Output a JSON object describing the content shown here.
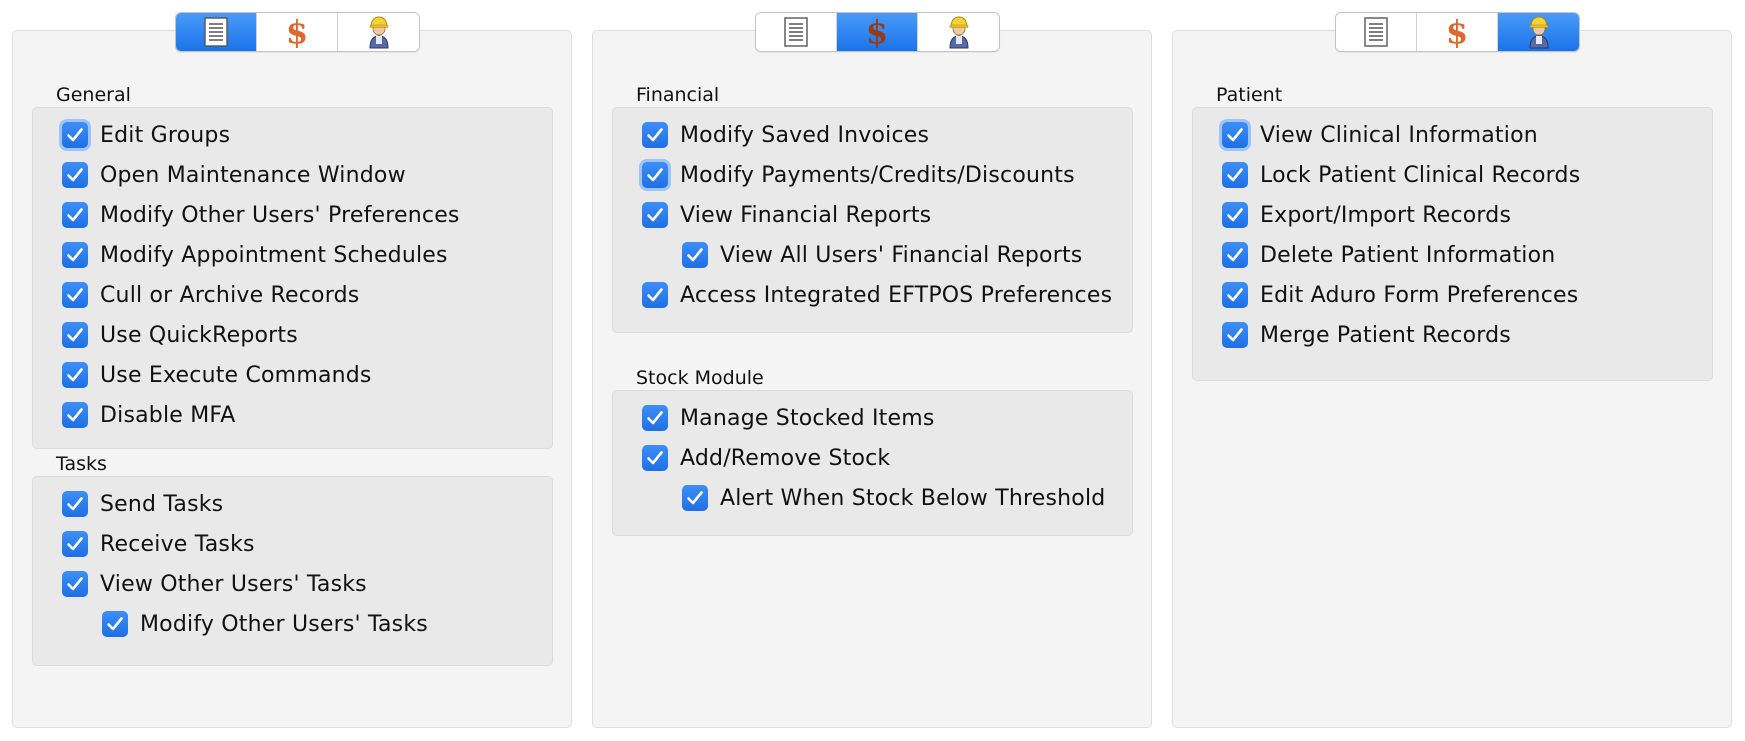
{
  "tab_icons": [
    "document-icon",
    "dollar-icon",
    "user-icon"
  ],
  "dollar_glyph": "$",
  "colors": {
    "accent": "#1f6fe5",
    "panel_bg": "#f4f4f4",
    "group_bg": "#e9e9e9",
    "dollar": "#e0662d"
  },
  "panels": [
    {
      "active_tab": 0,
      "sections": [
        {
          "title": "General",
          "items": [
            {
              "label": "Edit Groups",
              "checked": true,
              "focused": true
            },
            {
              "label": "Open Maintenance Window",
              "checked": true
            },
            {
              "label": "Modify Other Users' Preferences",
              "checked": true
            },
            {
              "label": "Modify Appointment Schedules",
              "checked": true
            },
            {
              "label": "Cull or Archive Records",
              "checked": true
            },
            {
              "label": "Use QuickReports",
              "checked": true
            },
            {
              "label": "Use Execute Commands",
              "checked": true
            },
            {
              "label": "Disable MFA",
              "checked": true
            }
          ]
        },
        {
          "title": "Tasks",
          "items": [
            {
              "label": "Send Tasks",
              "checked": true
            },
            {
              "label": "Receive Tasks",
              "checked": true
            },
            {
              "label": "View Other Users' Tasks",
              "checked": true
            },
            {
              "label": "Modify Other Users' Tasks",
              "checked": true,
              "indent": 1
            }
          ]
        }
      ]
    },
    {
      "active_tab": 1,
      "sections": [
        {
          "title": "Financial",
          "items": [
            {
              "label": "Modify Saved Invoices",
              "checked": true
            },
            {
              "label": "Modify Payments/Credits/Discounts",
              "checked": true,
              "focused": true
            },
            {
              "label": "View Financial Reports",
              "checked": true
            },
            {
              "label": "View All Users' Financial Reports",
              "checked": true,
              "indent": 1
            },
            {
              "label": "Access Integrated EFTPOS Preferences",
              "checked": true
            }
          ]
        },
        {
          "title": "Stock Module",
          "items": [
            {
              "label": "Manage Stocked Items",
              "checked": true
            },
            {
              "label": "Add/Remove Stock",
              "checked": true
            },
            {
              "label": "Alert When Stock Below Threshold",
              "checked": true,
              "indent": 1
            }
          ]
        }
      ]
    },
    {
      "active_tab": 2,
      "sections": [
        {
          "title": "Patient",
          "items": [
            {
              "label": "View Clinical Information",
              "checked": true,
              "focused": true
            },
            {
              "label": "Lock Patient Clinical Records",
              "checked": true
            },
            {
              "label": "Export/Import Records",
              "checked": true
            },
            {
              "label": "Delete Patient Information",
              "checked": true
            },
            {
              "label": "Edit Aduro Form Preferences",
              "checked": true
            },
            {
              "label": "Merge Patient Records",
              "checked": true
            }
          ]
        }
      ]
    }
  ]
}
